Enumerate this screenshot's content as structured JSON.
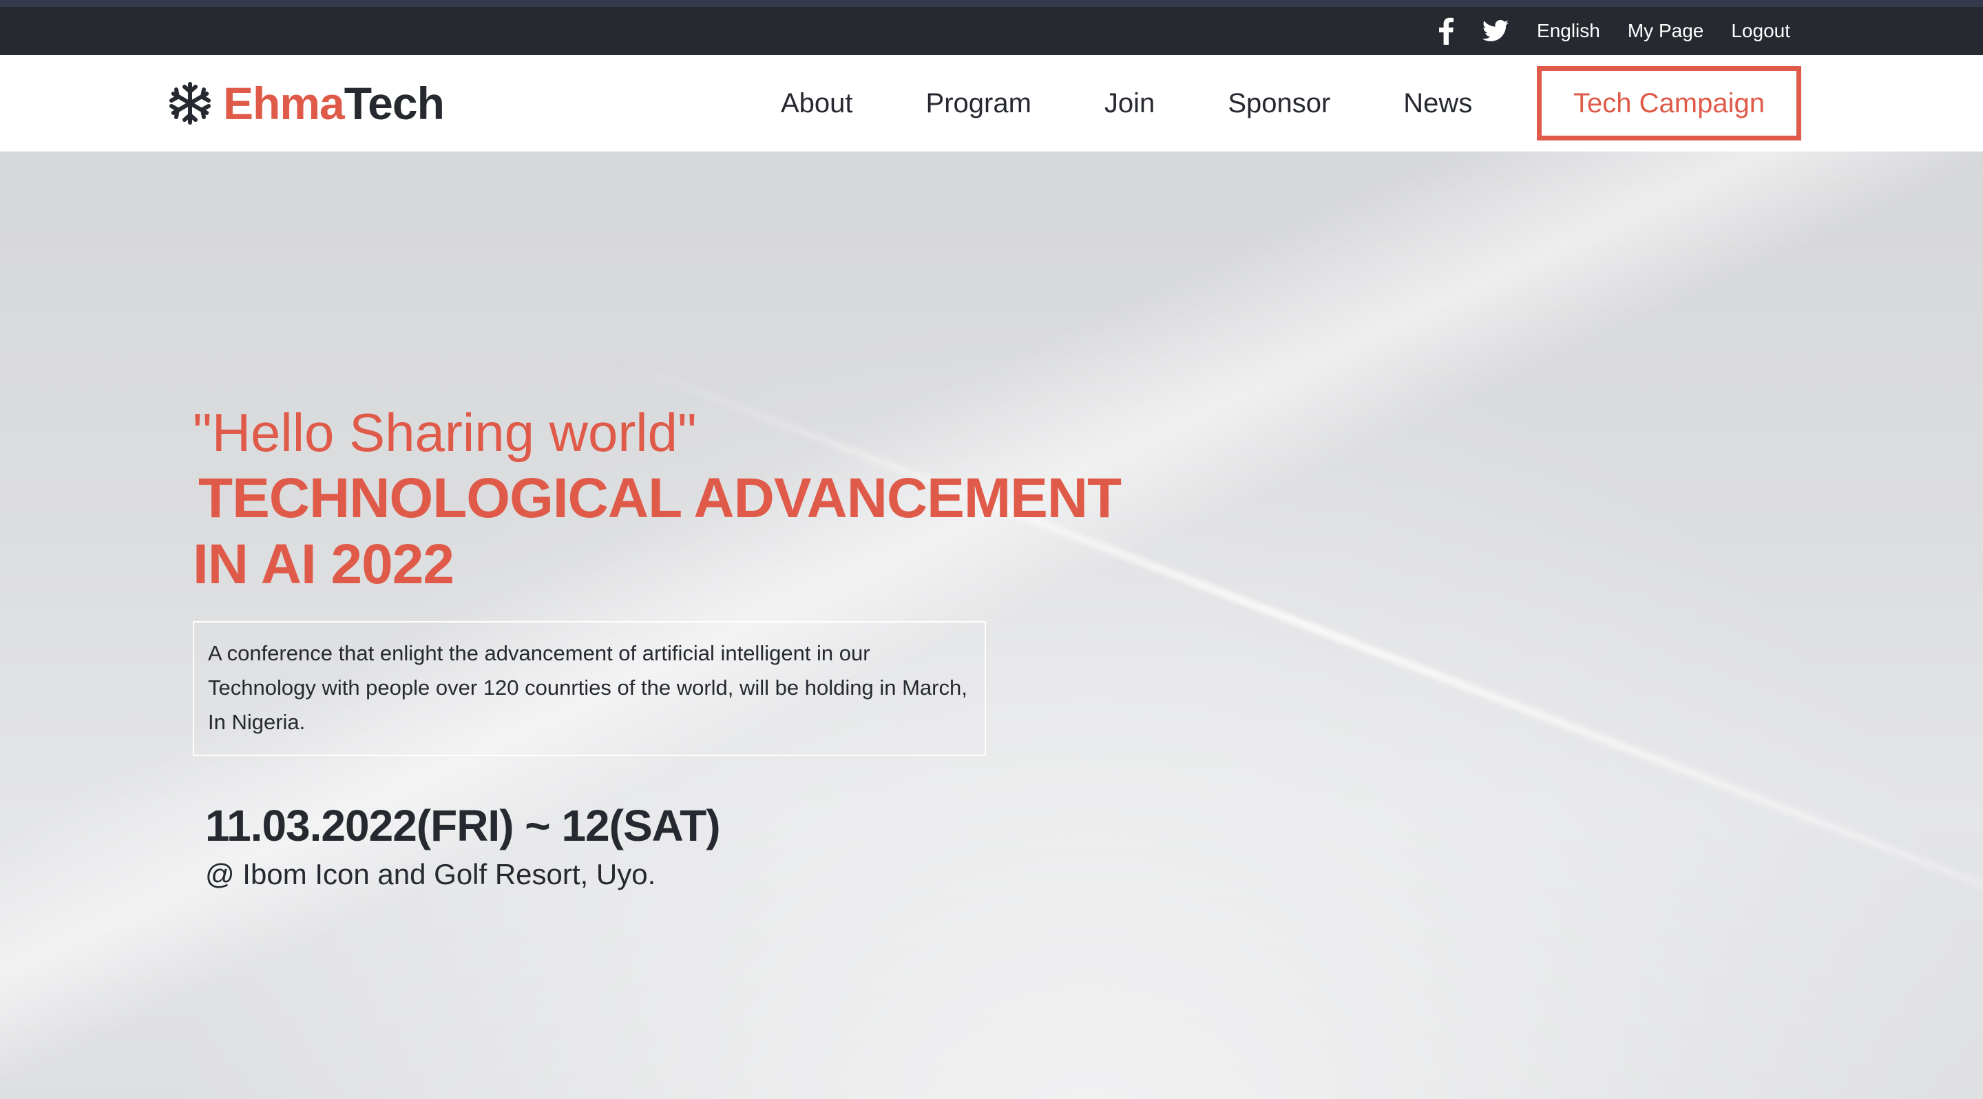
{
  "topbar": {
    "icons": {
      "facebook": "facebook-icon",
      "twitter": "twitter-icon"
    },
    "links": [
      "English",
      "My Page",
      "Logout"
    ]
  },
  "brand": {
    "name_part1": "Ehma",
    "name_part2": "Tech",
    "icon": "snowflake-icon",
    "accent_color": "#df5a48",
    "dark_color": "#262930"
  },
  "nav": {
    "items": [
      "About",
      "Program",
      "Join",
      "Sponsor",
      "News"
    ],
    "cta": "Tech Campaign"
  },
  "hero": {
    "quote": "\"Hello Sharing world\"",
    "title_line1": "TECHNOLOGICAL ADVANCEMENT",
    "title_line2": "IN AI 2022",
    "description": "A conference that enlight the advancement of artificial intelligent in our Technology with people over 120 counrties of the world, will be holding in March, In Nigeria.",
    "date": "11.03.2022(FRI) ~ 12(SAT)",
    "venue": "@ Ibom Icon and Golf Resort, Uyo."
  }
}
